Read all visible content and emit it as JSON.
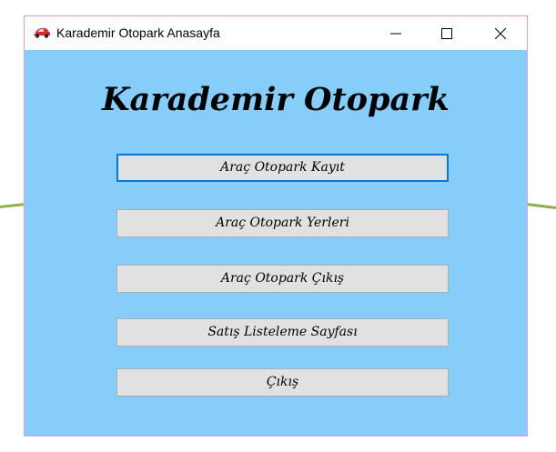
{
  "window": {
    "title": "Karademir Otopark Anasayfa",
    "icon": "car-icon",
    "controls": {
      "minimize": "minimize-icon",
      "maximize": "maximize-icon",
      "close": "close-icon"
    }
  },
  "main": {
    "heading": "Karademir Otopark",
    "buttons": [
      {
        "label": "Araç Otopark Kayıt",
        "focused": true
      },
      {
        "label": "Araç Otopark Yerleri",
        "focused": false
      },
      {
        "label": "Araç Otopark Çıkış",
        "focused": false
      },
      {
        "label": "Satış Listeleme Sayfası",
        "focused": false
      },
      {
        "label": "Çıkış",
        "focused": false
      }
    ]
  },
  "colors": {
    "form_background": "#87CDFA",
    "button_face": "#E1E1E1",
    "focus_border": "#0078D7",
    "icon_car": "#D32F2F"
  }
}
